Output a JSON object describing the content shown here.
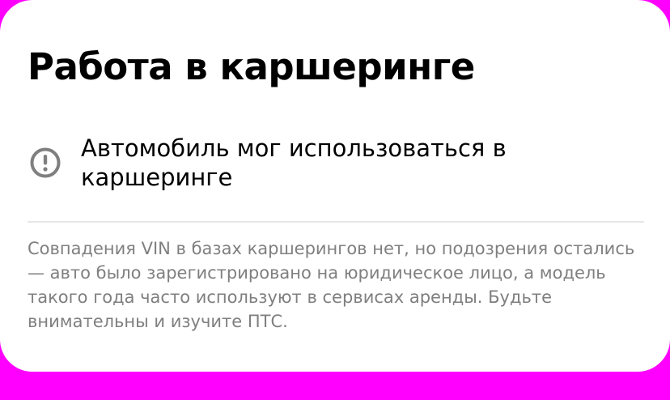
{
  "card": {
    "title": "Работа в каршеринге",
    "warning": {
      "icon": "exclamation-circle-icon",
      "text": "Автомобиль мог использоваться в каршеринге"
    },
    "description": "Совпадения VIN в базах каршерингов нет, но подозрения остались — авто было зарегистрировано на юридическое лицо, а модель такого года часто используют в сервисах аренды. Будьте внимательны и изучите ПТС."
  },
  "colors": {
    "background": "#ff00ff",
    "card": "#ffffff",
    "title": "#000000",
    "icon": "#7f7f7f",
    "description": "#7f7f7f",
    "divider": "#e7e7e7"
  }
}
